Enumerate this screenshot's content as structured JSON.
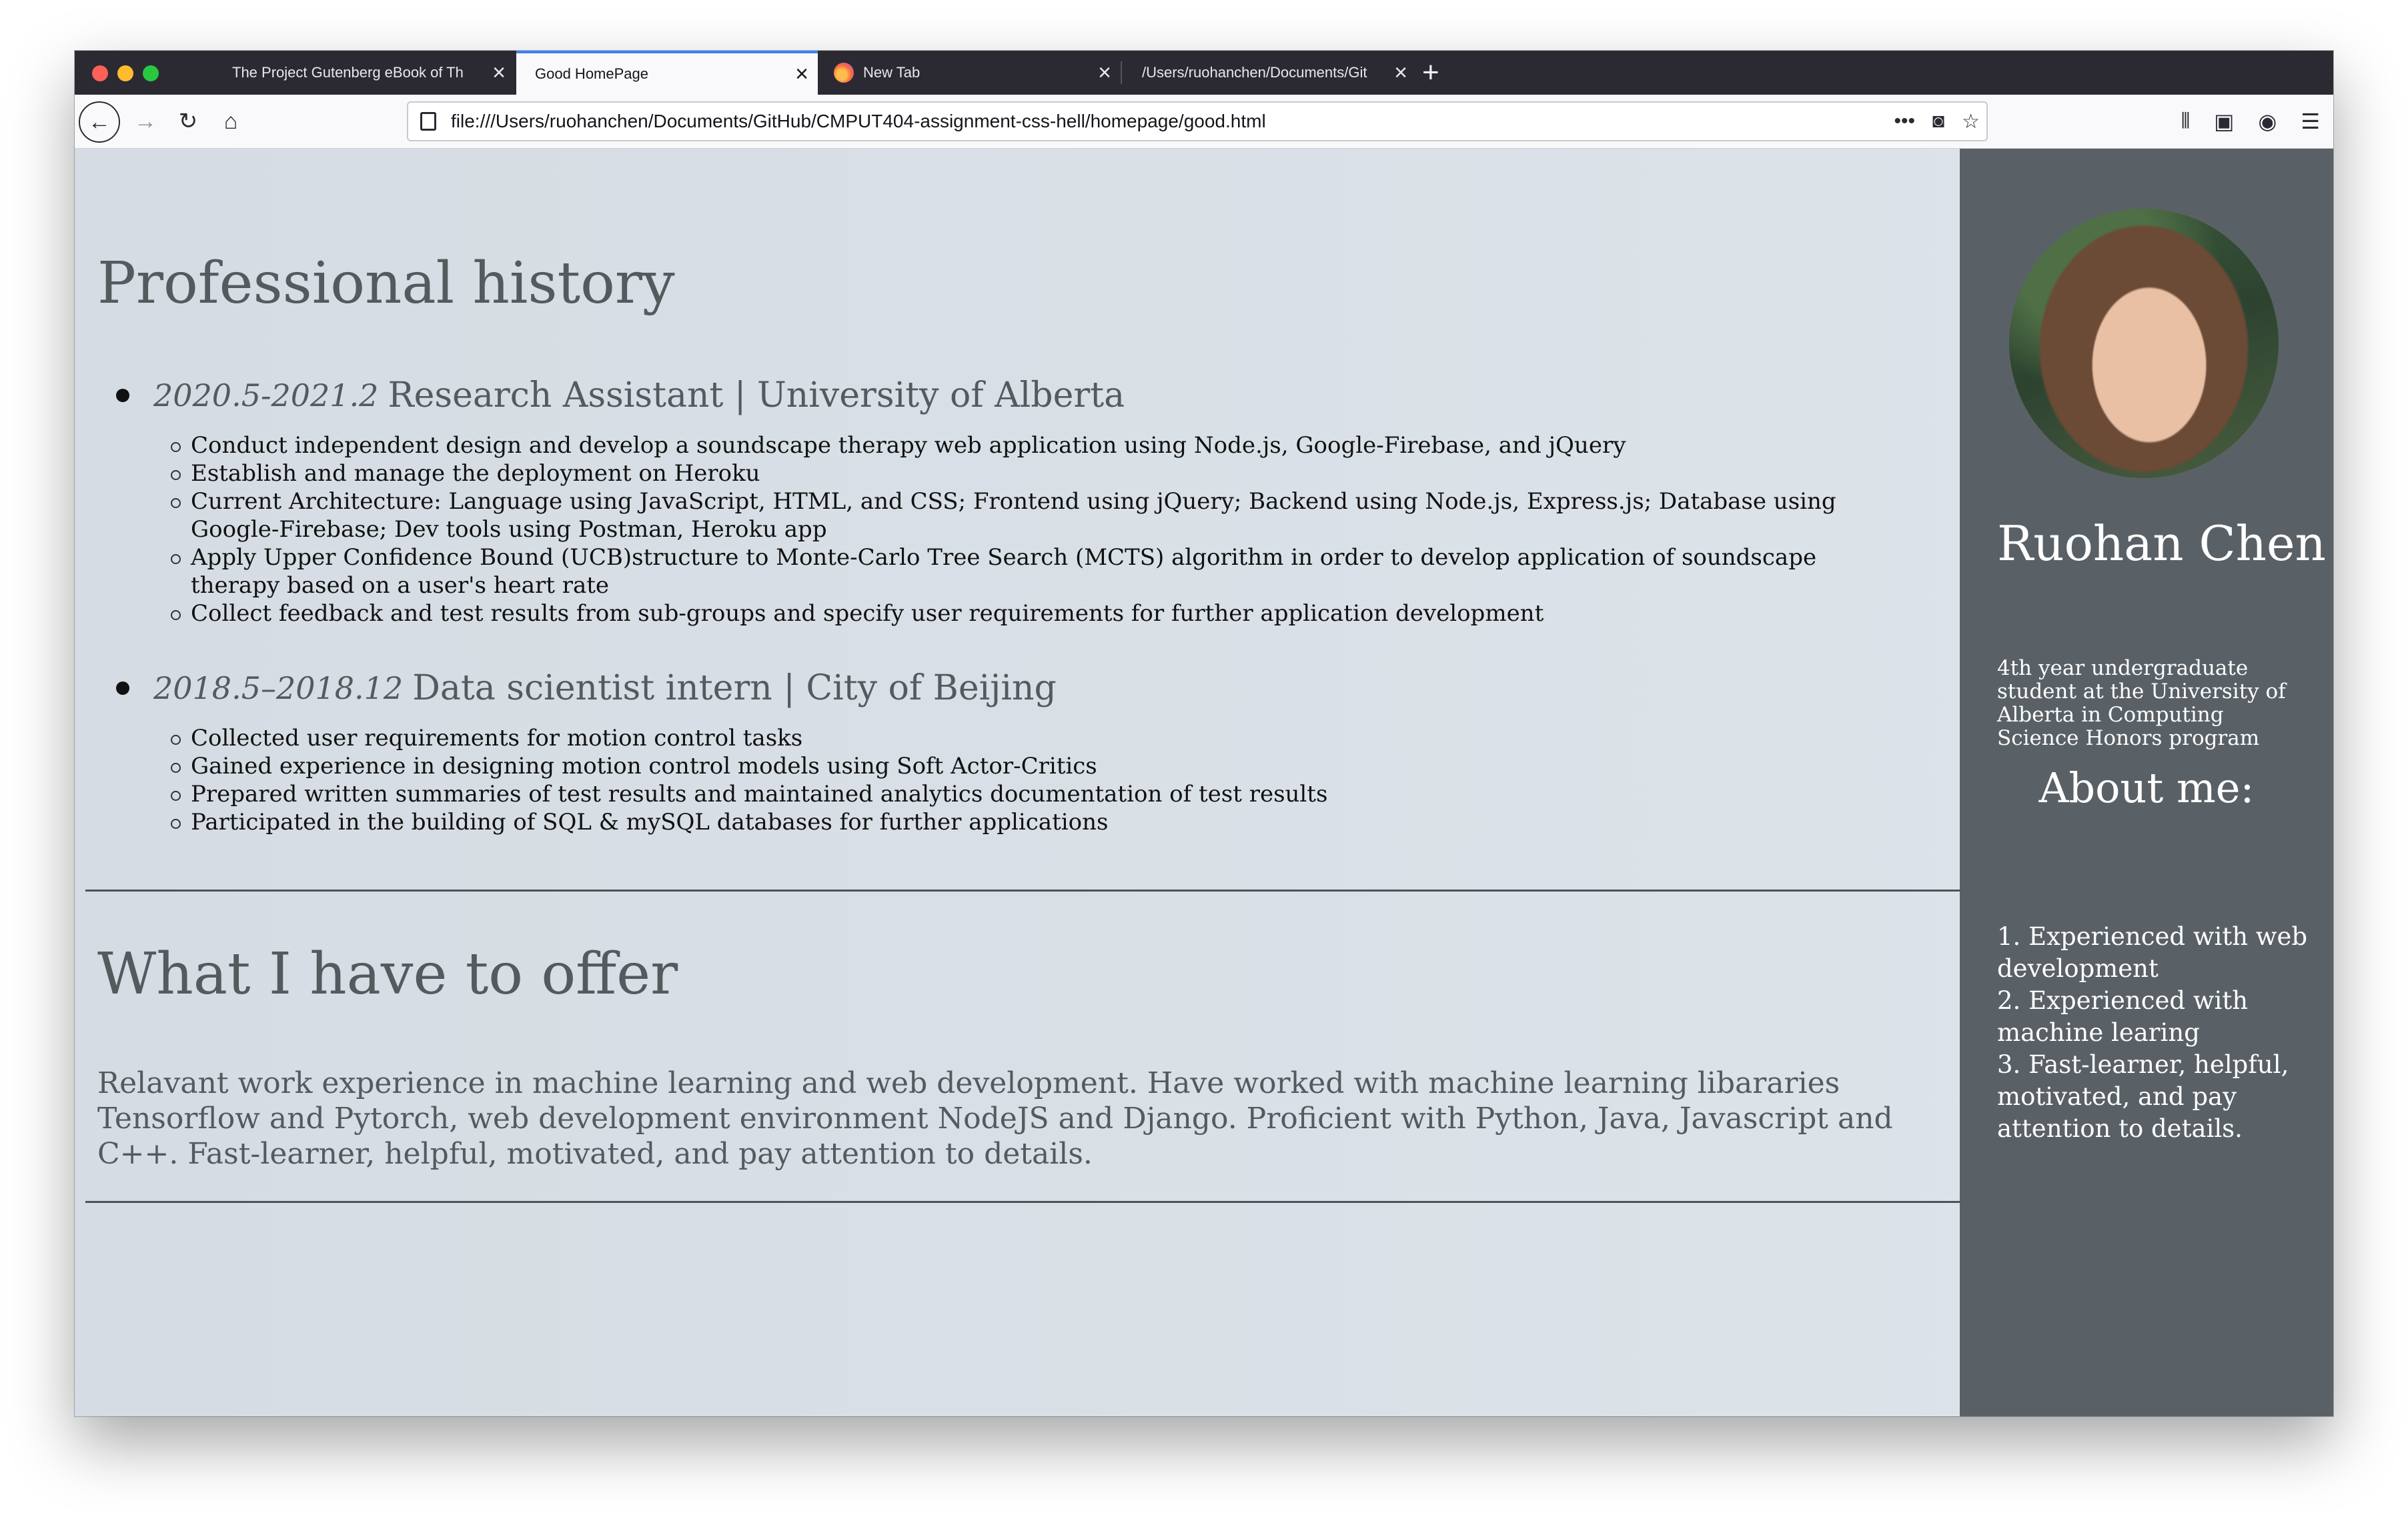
{
  "browser": {
    "tabs": [
      {
        "title": "The Project Gutenberg eBook of Th",
        "active": false
      },
      {
        "title": "Good HomePage",
        "active": true
      },
      {
        "title": "New Tab",
        "active": false
      },
      {
        "title": "/Users/ruohanchen/Documents/Git",
        "active": false
      }
    ],
    "url": "file:///Users/ruohanchen/Documents/GitHub/CMPUT404-assignment-css-hell/homepage/good.html",
    "icons": {
      "back": "back-arrow-icon",
      "forward": "forward-arrow-icon",
      "reload": "reload-icon",
      "home": "home-icon",
      "more": "more-icon",
      "pocket": "pocket-icon",
      "bookmark": "star-icon",
      "library": "library-icon",
      "sidebar": "sidebar-icon",
      "account": "account-icon",
      "menu": "hamburger-menu-icon"
    }
  },
  "main": {
    "history_title": "Professional history",
    "jobs": [
      {
        "date": "2020.5-2021.2",
        "title": "Research Assistant | University of Alberta",
        "items": [
          "Conduct independent design and develop a soundscape therapy web application using Node.js, Google-Firebase, and jQuery",
          "Establish and manage the deployment on Heroku",
          "Current Architecture: Language using JavaScript, HTML, and CSS; Frontend using jQuery; Backend using Node.js, Express.js; Database using Google-Firebase; Dev tools using Postman, Heroku app",
          "Apply Upper Confidence Bound (UCB)structure to Monte-Carlo Tree Search (MCTS) algorithm in order to develop application of soundscape therapy based on a user's heart rate",
          "Collect feedback and test results from sub-groups and specify user requirements for further application development"
        ]
      },
      {
        "date": "2018.5–2018.12",
        "title": "Data scientist intern | City of Beijing",
        "items": [
          "Collected user requirements for motion control tasks",
          "Gained experience in designing motion control models using Soft Actor-Critics",
          "Prepared written summaries of test results and maintained analytics documentation of test results",
          "Participated in the building of SQL & mySQL databases for further applications"
        ]
      }
    ],
    "offer_title": "What I have to offer",
    "offer_text": "Relavant work experience in machine learning and web development. Have worked with machine learning libararies Tensorflow and Pytorch, web development environment NodeJS and Django. Proficient with Python, Java, Javascript and C++. Fast-learner, helpful, motivated, and pay attention to details."
  },
  "sidebar": {
    "name": "Ruohan Chen",
    "tagline": "4th year undergraduate student at the University of Alberta in Computing Science Honors program",
    "about_title": "About me:",
    "about_items": [
      "1. Experienced with web development",
      "2. Experienced with machine learing",
      "3. Fast-learner, helpful, motivated, and pay attention to details."
    ]
  }
}
